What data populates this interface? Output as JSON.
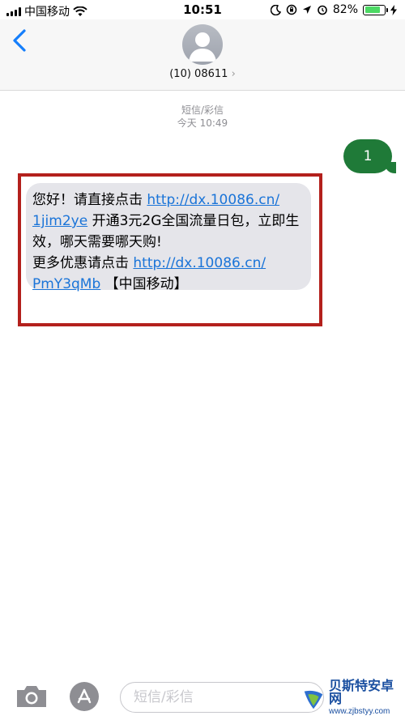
{
  "status_bar": {
    "carrier": "中国移动",
    "time": "10:51",
    "battery": "82%",
    "battery_level": 0.82,
    "battery_color": "#4cd964"
  },
  "header": {
    "contact": "(10) 08611",
    "chevron": "›"
  },
  "conversation": {
    "service": "短信/彩信",
    "timestamp": "今天 10:49",
    "outgoing": {
      "text": "1",
      "color": "#1f7a38"
    },
    "incoming": {
      "line1_text": "您好！请直接点击 ",
      "line1_link": "http://dx.10086.cn/",
      "line2_link": "1jim2ye",
      "line2_text": " 开通3元2G全国流量日包，立即生效，哪天需要哪天购!",
      "line3_text": "更多优惠请点击 ",
      "line3_link": "http://dx.10086.cn/",
      "line4_link": "PmY3qMb",
      "line4_text": " 【中国移动】",
      "link_color": "#1a74d8",
      "highlight_color": "#b3201c"
    }
  },
  "input_bar": {
    "placeholder": "短信/彩信",
    "icons": [
      "camera-icon",
      "app-store-icon"
    ]
  },
  "watermark": {
    "title": "贝斯特安卓网",
    "url": "www.zjbstyy.com"
  }
}
